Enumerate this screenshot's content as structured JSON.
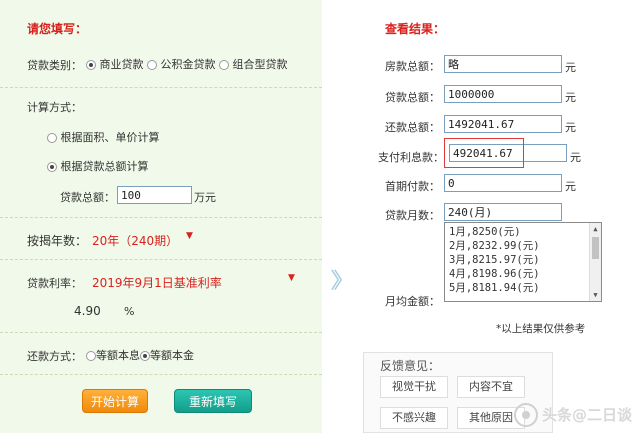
{
  "left": {
    "title": "请您填写：",
    "loan_type": {
      "label": "贷款类别：",
      "options": [
        "商业贷款",
        "公积金贷款",
        "组合型贷款"
      ],
      "selected": 0
    },
    "calc_method": {
      "label": "计算方式：",
      "options": [
        "根据面积、单价计算",
        "根据贷款总额计算"
      ],
      "selected": 1
    },
    "loan_total": {
      "label": "贷款总额：",
      "value": "100",
      "unit": "万元"
    },
    "years": {
      "label": "按揭年数：",
      "value": "20年（240期）"
    },
    "rate": {
      "label": "贷款利率：",
      "value": "2019年9月1日基准利率",
      "number": "4.90",
      "unit": "%"
    },
    "repay": {
      "label": "还款方式：",
      "options": [
        "等额本息",
        "等额本金"
      ],
      "selected": 1
    },
    "buttons": {
      "calculate": "开始计算",
      "reset": "重新填写"
    }
  },
  "right": {
    "title": "查看结果：",
    "rows": [
      {
        "label": "房款总额：",
        "value": "略",
        "unit": "元"
      },
      {
        "label": "贷款总额：",
        "value": "1000000",
        "unit": "元"
      },
      {
        "label": "还款总额：",
        "value": "1492041.67",
        "unit": "元"
      },
      {
        "label": "支付利息款：",
        "value": "492041.67",
        "unit": "元"
      },
      {
        "label": "首期付款：",
        "value": "0",
        "unit": "元"
      },
      {
        "label": "贷款月数：",
        "value": "240(月)",
        "unit": ""
      }
    ],
    "monthly_label": "月均金额：",
    "monthly_list": [
      "1月,8250(元)",
      "2月,8232.99(元)",
      "3月,8215.97(元)",
      "4月,8198.96(元)",
      "5月,8181.94(元)"
    ],
    "note": "*以上结果仅供参考"
  },
  "feedback": {
    "title": "反馈意见：",
    "options": [
      "视觉干扰",
      "内容不宜",
      "不感兴趣",
      "其他原因"
    ]
  },
  "watermark": "头条@二日谈",
  "colors": {
    "accent_red": "#d9221e",
    "left_bg": "#f1f9ea",
    "orange": "#f08a0a",
    "teal": "#129e8a"
  }
}
